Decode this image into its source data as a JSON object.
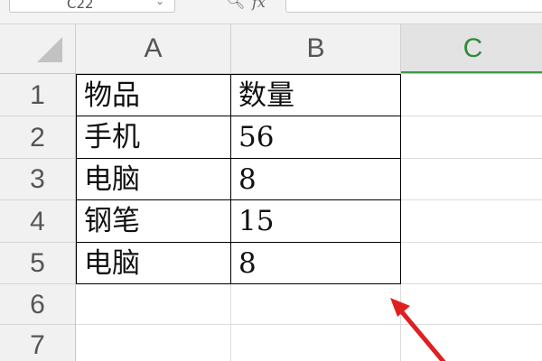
{
  "formula_bar": {
    "name_box_value": "C22",
    "name_box_arrow_icon": "chevron-down-icon",
    "zoom_icon": "zoom-icon",
    "fx_label": "fx"
  },
  "columns": [
    "A",
    "B",
    "C"
  ],
  "rows": [
    "1",
    "2",
    "3",
    "4",
    "5",
    "6",
    "7"
  ],
  "cells": {
    "a1": "物品",
    "b1": "数量",
    "a2": "手机",
    "b2": "56",
    "a3": "电脑",
    "b3": "8",
    "a4": "钢笔",
    "b4": "15",
    "a5": "电脑",
    "b5": "8"
  },
  "colors": {
    "selected_column_text": "#2e8b3a",
    "arrow": "#e02020"
  }
}
